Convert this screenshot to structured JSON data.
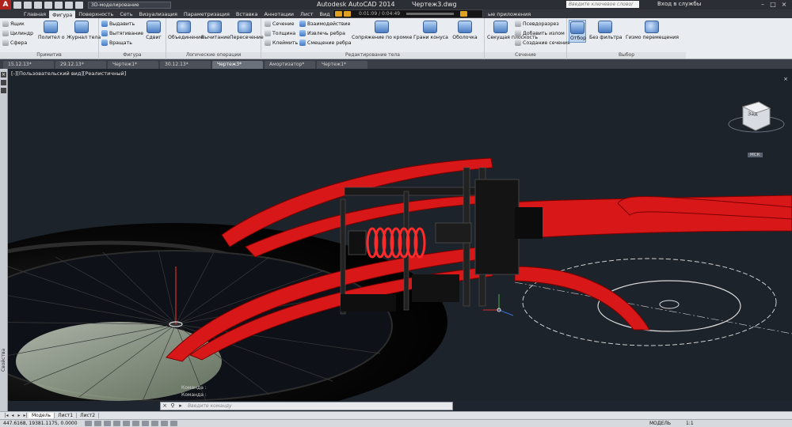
{
  "titlebar": {
    "app_title": "Autodesk AutoCAD 2014",
    "doc_title": "Чертеж3.dwg",
    "workspace": "3D-моделирование",
    "search_placeholder": "Введите ключевое слово/фразу",
    "sign_in": "Вход в службы",
    "media_time": "0:01:09 / 0:04:49"
  },
  "ribbon_tabs": [
    "Главная",
    "Фигура",
    "Поверхность",
    "Сеть",
    "Визуализация",
    "Параметризация",
    "Вставка",
    "Аннотации",
    "Лист",
    "Вид",
    "Упр"
  ],
  "ribbon_tab_extra": "ые приложения",
  "ribbon": {
    "primitives": {
      "label": "Примитив",
      "box": "Ящик",
      "cylinder": "Цилиндр",
      "sphere": "Сфера",
      "polysolid": "Полител о",
      "history": "Журнал тела"
    },
    "solid": {
      "label": "Фигура",
      "extrude": "Выдавить",
      "presspull": "Вытягивание",
      "revolve": "Вращать",
      "sweep": "Сдвиг"
    },
    "boolean": {
      "label": "Логические операции",
      "union": "Объединение",
      "subtract": "Вычитание",
      "intersect": "Пересечение"
    },
    "edit": {
      "label": "Редактирование тела",
      "slice": "Сечение",
      "thicken": "Толщина",
      "imprint": "Клеймить",
      "interfere": "Взаимодействие",
      "extract_edges": "Извлечь ребра",
      "offset_edges": "Смещение ребра",
      "fillet": "Сопряжение по кромке",
      "taper": "Грани конуса",
      "shell": "Оболочка"
    },
    "section": {
      "label": "Сечение",
      "plane": "Секущая плоскость",
      "pseudo": "Псевдоразрез",
      "add_jog": "Добавить излом",
      "generate": "Создание сечения"
    },
    "selection": {
      "label": "Выбор",
      "culling": "Отбор",
      "no_filter": "Без фильтра",
      "gizmo": "Гизмо перемещения"
    }
  },
  "doc_tabs": [
    "15.12.13*",
    "29.12.13*",
    "Чертеж1*",
    "30.12.13*",
    "Чертеж3*",
    "Амортизатор*",
    "Чертеж1*"
  ],
  "viewport_label": "[-][Пользовательский вид][Реалистичный]",
  "palette_label": "Свойства",
  "viewcube_face": "Зад",
  "wcs": "МСК",
  "command": {
    "history": [
      "Команда :",
      "Команда :"
    ],
    "placeholder": "Введите команду"
  },
  "layout_tabs": [
    "Модель",
    "Лист1",
    "Лист2"
  ],
  "status": {
    "coords": "447.6168, 19381.1175, 0.0000",
    "model": "МОДЕЛЬ",
    "scale": "1:1"
  },
  "colors": {
    "frame": "#e01b1b",
    "tire": "#0a0a0a",
    "viewport_bg": "#1d232b"
  }
}
